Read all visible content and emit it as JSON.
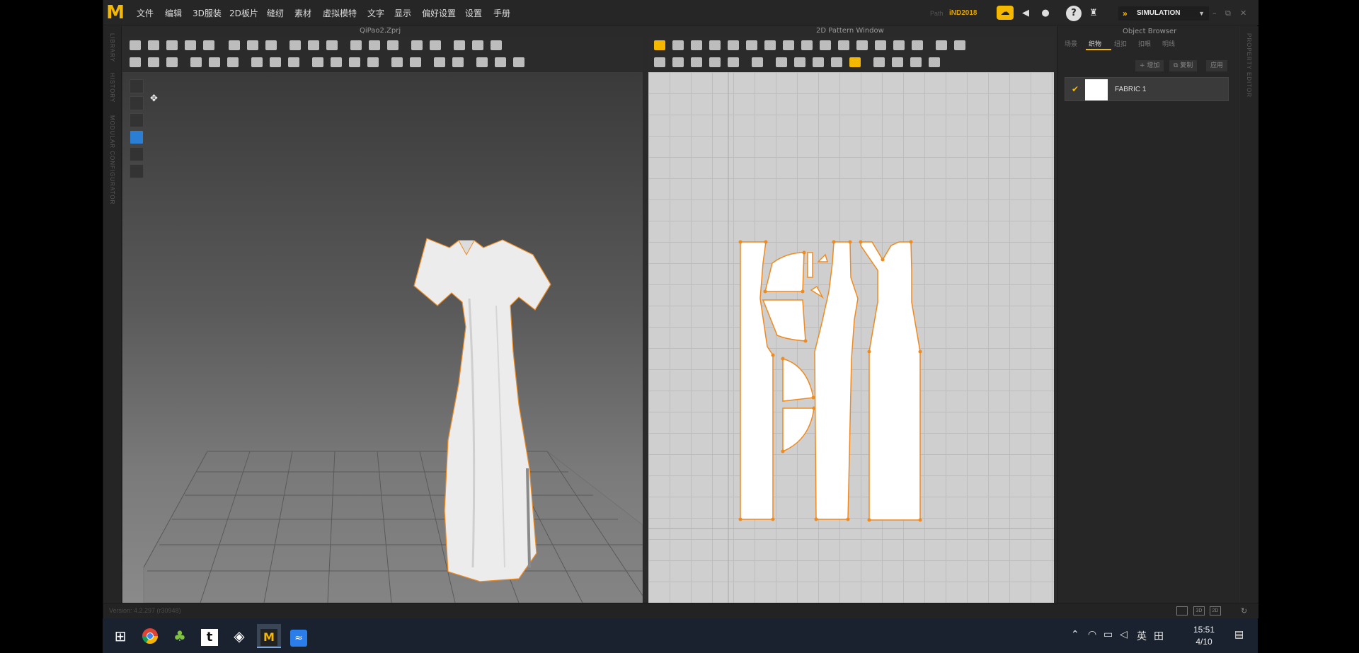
{
  "app": {
    "logo": "M",
    "menu": [
      "文件",
      "编辑",
      "3D服装",
      "2D板片",
      "缝纫",
      "素材",
      "虚拟模特",
      "文字",
      "显示",
      "偏好设置",
      "设置",
      "手册"
    ],
    "user_label": "Path",
    "user_name": "iND2018",
    "mode": "SIMULATION",
    "accent_color": "#f5b800"
  },
  "left_strip": {
    "labels": [
      "LIBRARY",
      "HISTORY",
      "MODULAR CONFIGURATOR"
    ]
  },
  "view3d": {
    "title": "QiPao2.Zprj"
  },
  "view2d": {
    "title": "2D Pattern Window",
    "outline_color": "#f08a1e"
  },
  "object_browser": {
    "title": "Object Browser",
    "tabs": [
      "场景",
      "织物",
      "纽扣",
      "扣眼",
      "明线"
    ],
    "buttons": {
      "add": "+ 增加",
      "copy": "⧉ 复制",
      "apply": "应用"
    },
    "fabrics": [
      {
        "name": "FABRIC 1"
      }
    ]
  },
  "right_strip": {
    "label": "PROPERTY EDITOR"
  },
  "status": {
    "version": "Version: 4.2.297 (r30948)"
  },
  "view_buttons": [
    "",
    "3D",
    "2D"
  ],
  "taskbar": {
    "apps": [
      "windows-start",
      "chrome",
      "clover",
      "typora",
      "unity",
      "marvelous-designer",
      "feishu"
    ],
    "tray_ime": "英",
    "tray_ime2": "田",
    "time": "15:51",
    "date": "4/10"
  }
}
